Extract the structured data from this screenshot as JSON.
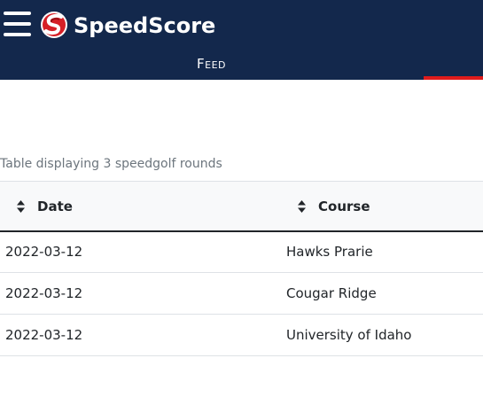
{
  "navbar": {
    "brand": "SpeedScore",
    "tabs": [
      {
        "label": "Feed",
        "active": false
      }
    ],
    "colors": {
      "background": "#13284c",
      "accent": "#e01b1b"
    }
  },
  "rounds_table": {
    "caption": "Table displaying 3 speedgolf rounds",
    "headers": {
      "date": "Date",
      "course": "Course"
    },
    "rows": [
      {
        "date": "2022-03-12",
        "course": "Hawks Prarie"
      },
      {
        "date": "2022-03-12",
        "course": "Cougar Ridge"
      },
      {
        "date": "2022-03-12",
        "course": "University of Idaho"
      }
    ]
  }
}
